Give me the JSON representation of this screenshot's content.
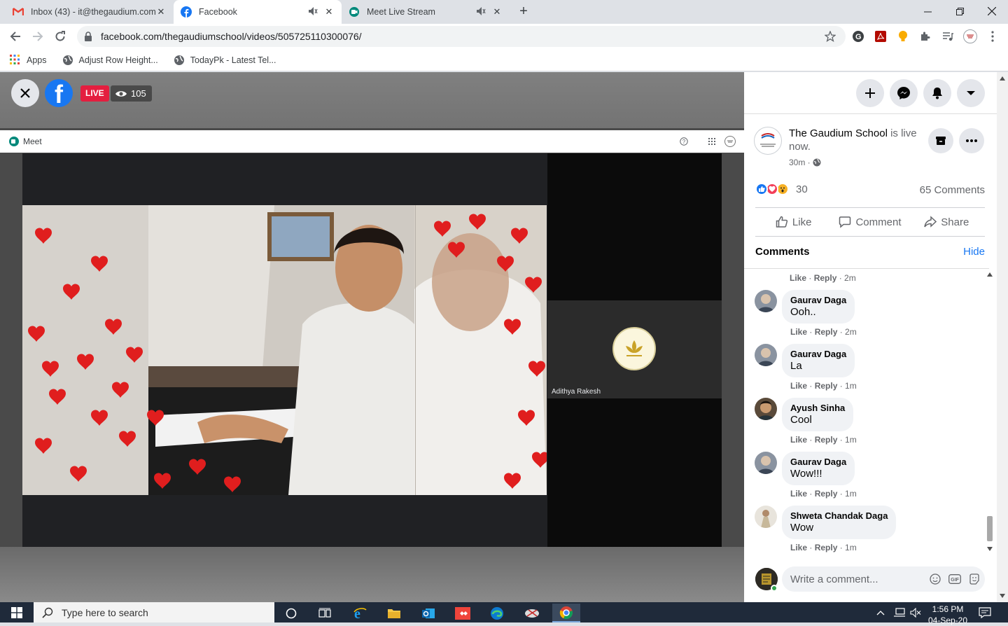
{
  "browser": {
    "tabs": [
      {
        "title": "Inbox (43) - it@thegaudium.com",
        "favicon": "gmail-icon"
      },
      {
        "title": "Facebook",
        "favicon": "facebook-icon",
        "active": true
      },
      {
        "title": "Meet Live Stream",
        "favicon": "meet-icon"
      }
    ],
    "url": "facebook.com/thegaudiumschool/videos/505725110300076/",
    "bookmarks": [
      {
        "label": "Apps",
        "icon": "apps-grid-icon"
      },
      {
        "label": "Adjust Row Height...",
        "icon": "globe-icon"
      },
      {
        "label": "TodayPk - Latest Tel...",
        "icon": "globe-icon"
      }
    ]
  },
  "video": {
    "live_label": "LIVE",
    "viewer_count": "105",
    "meet_label": "Meet",
    "participant_name": "Adithya Rakesh"
  },
  "post": {
    "page_name": "The Gaudium School",
    "status_text": " is live now.",
    "time": "30m",
    "reaction_count": "30",
    "comments_count": "65 Comments",
    "actions": {
      "like": "Like",
      "comment": "Comment",
      "share": "Share"
    }
  },
  "comments_panel": {
    "title": "Comments",
    "hide_label": "Hide",
    "top_meta": {
      "like": "Like",
      "reply": "Reply",
      "time": "2m"
    },
    "items": [
      {
        "author": "Gaurav Daga",
        "text": "Ooh..",
        "like": "Like",
        "reply": "Reply",
        "time": "2m"
      },
      {
        "author": "Gaurav Daga",
        "text": "La",
        "like": "Like",
        "reply": "Reply",
        "time": "1m"
      },
      {
        "author": "Ayush Sinha",
        "text": "Cool",
        "like": "Like",
        "reply": "Reply",
        "time": "1m"
      },
      {
        "author": "Gaurav Daga",
        "text": "Wow!!!",
        "like": "Like",
        "reply": "Reply",
        "time": "1m"
      },
      {
        "author": "Shweta Chandak Daga",
        "text": "Wow",
        "like": "Like",
        "reply": "Reply",
        "time": "1m"
      }
    ],
    "write_placeholder": "Write a comment..."
  },
  "taskbar": {
    "search_placeholder": "Type here to search",
    "time": "1:56 PM",
    "date": "04-Sep-20"
  },
  "colors": {
    "fb_blue": "#1877f2",
    "live_red": "#e41e3f"
  }
}
